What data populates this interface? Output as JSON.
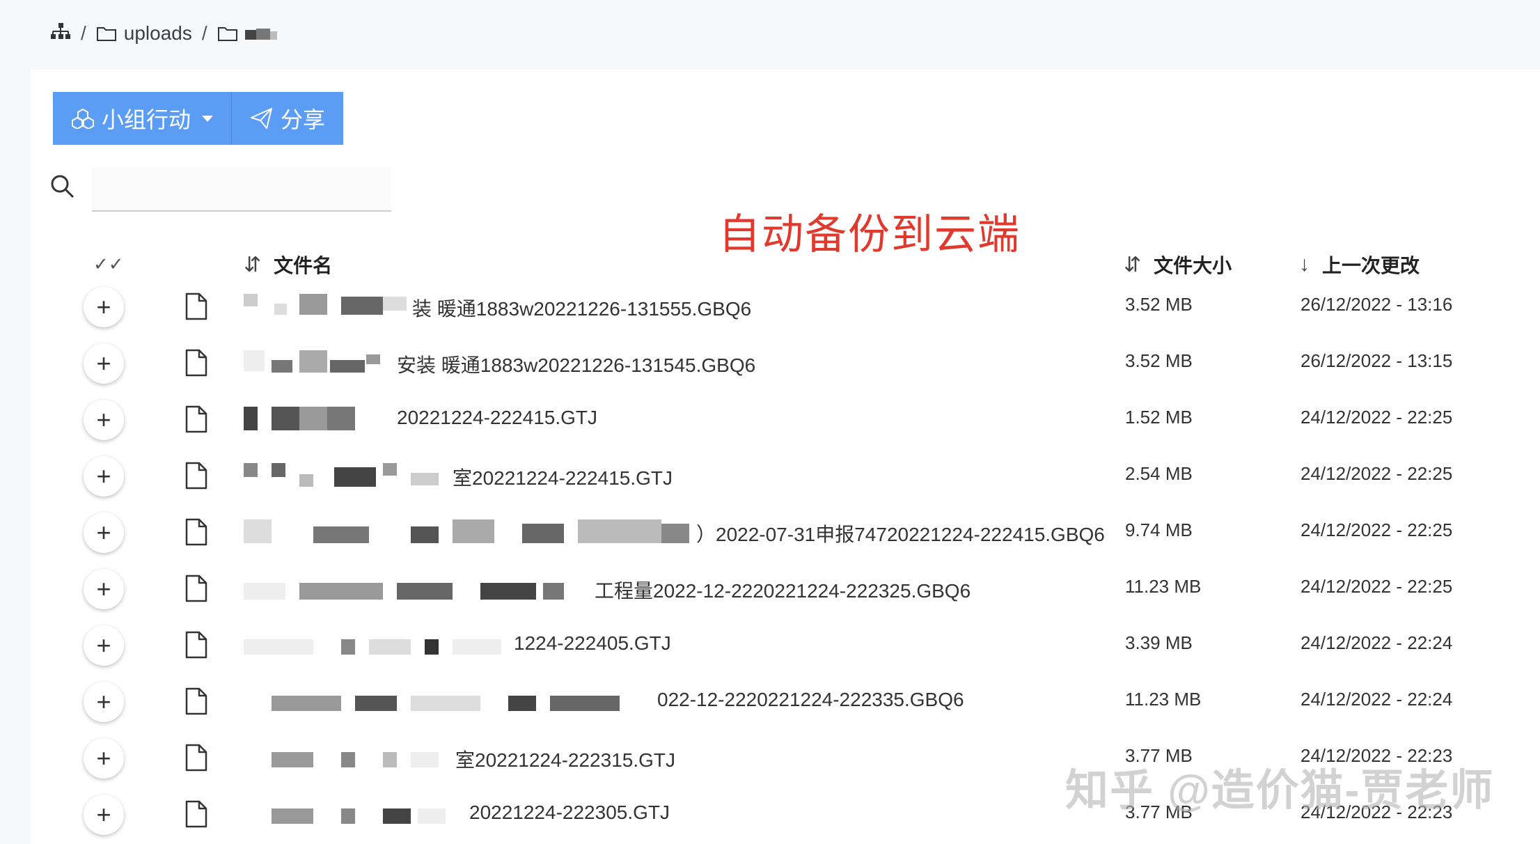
{
  "breadcrumb": {
    "root_icon": "sitemap-icon",
    "items": [
      "uploads",
      ""
    ],
    "separator": "/"
  },
  "toolbar": {
    "group_action_label": "小组行动",
    "share_label": "分享",
    "accent": "#5b9df5"
  },
  "search": {
    "value": "",
    "placeholder": ""
  },
  "overlay_title": "自动备份到云端",
  "table": {
    "headers": {
      "name": "文件名",
      "size": "文件大小",
      "modified": "上一次更改"
    },
    "rows": [
      {
        "name": "装 暖通1883w20221226-131555.GBQ6",
        "size": "3.52 MB",
        "modified": "26/12/2022 - 13:16"
      },
      {
        "name": "安装 暖通1883w20221226-131545.GBQ6",
        "size": "3.52 MB",
        "modified": "26/12/2022 - 13:15"
      },
      {
        "name": "20221224-222415.GTJ",
        "size": "1.52 MB",
        "modified": "24/12/2022 - 22:25"
      },
      {
        "name": "室20221224-222415.GTJ",
        "size": "2.54 MB",
        "modified": "24/12/2022 - 22:25"
      },
      {
        "name": "）2022-07-31申报74720221224-222415.GBQ6",
        "size": "9.74 MB",
        "modified": "24/12/2022 - 22:25"
      },
      {
        "name": "工程量2022-12-2220221224-222325.GBQ6",
        "size": "11.23 MB",
        "modified": "24/12/2022 - 22:25"
      },
      {
        "name": "1224-222405.GTJ",
        "size": "3.39 MB",
        "modified": "24/12/2022 - 22:24"
      },
      {
        "name": "022-12-2220221224-222335.GBQ6",
        "size": "11.23 MB",
        "modified": "24/12/2022 - 22:24"
      },
      {
        "name": "室20221224-222315.GTJ",
        "size": "3.77 MB",
        "modified": "24/12/2022 - 22:23"
      },
      {
        "name": "20221224-222305.GTJ",
        "size": "3.77 MB",
        "modified": "24/12/2022 - 22:23"
      }
    ]
  },
  "watermark": "知乎 @造价猫-贾老师"
}
